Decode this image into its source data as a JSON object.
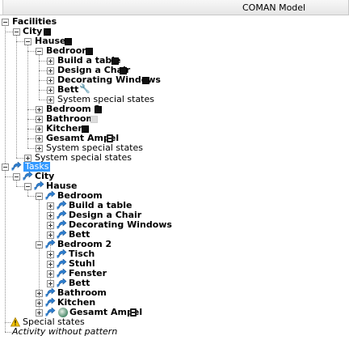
{
  "header": {
    "column_label": "COMAN Model"
  },
  "tree": {
    "facilities": {
      "label": "Facilities",
      "city": "City",
      "hause": "Hause",
      "bedroom": "Bedroom",
      "bedroom_children": [
        "Build a table",
        "Design a Chair",
        "Decorating Windows",
        "Bett"
      ],
      "system_special_states": "System special states",
      "bedroom2": "Bedroom 2",
      "bathroom": "Bathroom",
      "kitchen": "Kitchen",
      "gesamt_ampel": "Gesamt Ampel",
      "hause_system_special_states": "System special states",
      "city_system_special_states": "System special states"
    },
    "tasks": {
      "label": "Tasks",
      "city": "City",
      "hause": "Hause",
      "bedroom": "Bedroom",
      "bedroom_children": [
        "Build a table",
        "Design a Chair",
        "Decorating Windows",
        "Bett"
      ],
      "bedroom2": "Bedroom 2",
      "bedroom2_children": [
        "Tisch",
        "Stuhl",
        "Fenster",
        "Bett"
      ],
      "bathroom": "Bathroom",
      "kitchen": "Kitchen",
      "gesamt_ampel": "Gesamt Ampel"
    },
    "special_states": "Special states",
    "activity_without_pattern": "Activity without pattern"
  },
  "icons": {
    "status_square": "black-square-icon",
    "status_square_grey": "grey-square-icon",
    "wrench": "wrench-icon",
    "traffic_light": "traffic-light-icon",
    "task": "task-arrow-icon",
    "warning": "warning-icon",
    "globe": "globe-icon"
  },
  "colors": {
    "selection": "#3399ff",
    "task_icon": "#2f7fd0",
    "warning": "#f2c200"
  }
}
